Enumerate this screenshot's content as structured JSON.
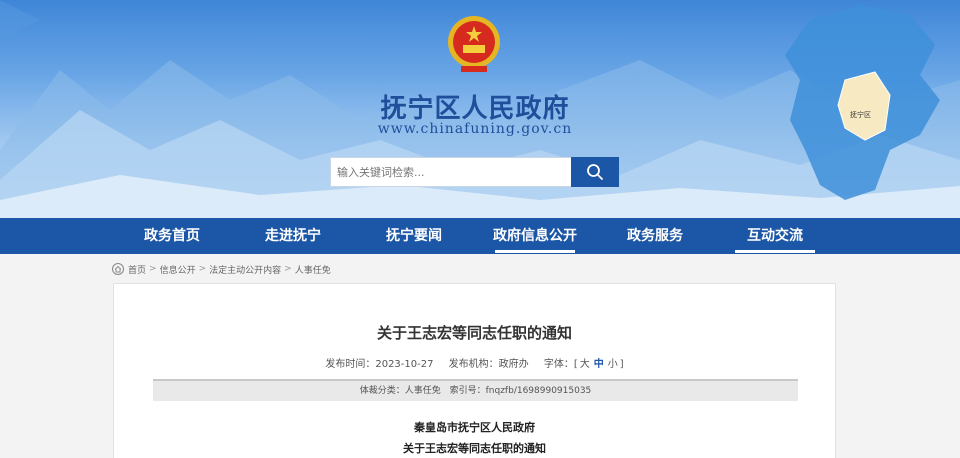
{
  "header": {
    "title": "抚宁区人民政府",
    "url": "www.chinafuning.gov.cn"
  },
  "search": {
    "placeholder": "输入关键词检索..."
  },
  "map": {
    "label": "抚宁区"
  },
  "nav": {
    "items": [
      {
        "label": "政务首页"
      },
      {
        "label": "走进抚宁"
      },
      {
        "label": "抚宁要闻"
      },
      {
        "label": "政府信息公开"
      },
      {
        "label": "政务服务"
      },
      {
        "label": "互动交流"
      }
    ]
  },
  "breadcrumb": {
    "items": [
      "首页",
      "信息公开",
      "法定主动公开内容",
      "人事任免"
    ],
    "separator": ">"
  },
  "article": {
    "title": "关于王志宏等同志任职的通知",
    "publish_time_label": "发布时间：",
    "publish_time": "2023-10-27",
    "publisher_label": "发布机构：",
    "publisher": "政府办",
    "font_label": "字体：",
    "font_open": "[",
    "font_large": "大",
    "font_medium": "中",
    "font_small": "小",
    "font_close": "]",
    "category_label": "体裁分类：",
    "category": "人事任免",
    "index_label": "索引号：",
    "index": "fnqzfb/1698990915035",
    "body": [
      "秦皇岛市抚宁区人民政府",
      "关于王志宏等同志任职的通知"
    ]
  },
  "colors": {
    "nav_bg": "#1c56a6",
    "title_blue": "#1f4f9b"
  }
}
